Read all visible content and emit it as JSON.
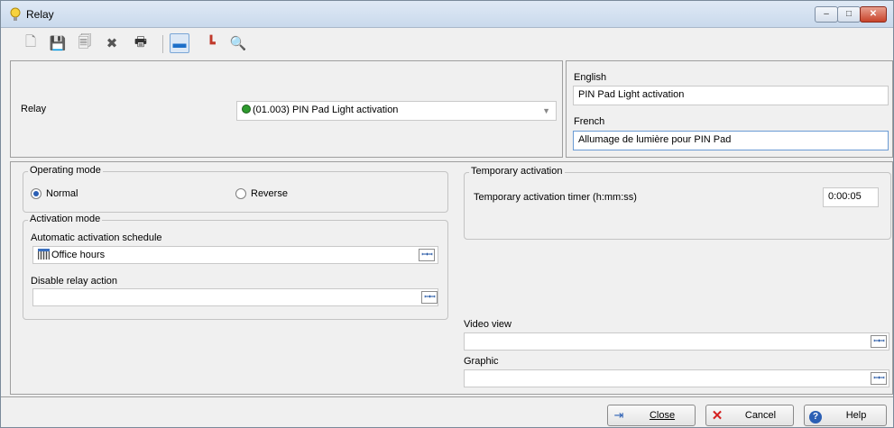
{
  "window": {
    "title": "Relay",
    "icon": "lightbulb-icon",
    "controls": {
      "minimize": "–",
      "maximize": "□",
      "close": "✕"
    }
  },
  "toolbar": {
    "items": [
      {
        "name": "new-icon",
        "glyph": "🗋"
      },
      {
        "name": "save-icon",
        "glyph": "💾"
      },
      {
        "name": "save-as-icon",
        "glyph": "🗐"
      },
      {
        "name": "delete-icon",
        "glyph": "✖"
      },
      {
        "name": "print-icon",
        "glyph": "🖶"
      },
      {
        "name": "link-icon",
        "glyph": "▬"
      },
      {
        "name": "relay-icon",
        "glyph": "┗"
      },
      {
        "name": "search-icon",
        "glyph": "🔍"
      }
    ]
  },
  "relay": {
    "label": "Relay",
    "selected": "(01.003) PIN Pad Light activation",
    "status_color": "#2e9a2e"
  },
  "names": {
    "english_label": "English",
    "english_value": "PIN Pad Light activation",
    "french_label": "French",
    "french_value": "Allumage de lumière pour PIN Pad"
  },
  "operating_mode": {
    "title": "Operating mode",
    "options": [
      {
        "label": "Normal",
        "checked": true
      },
      {
        "label": "Reverse",
        "checked": false
      }
    ]
  },
  "activation_mode": {
    "title": "Activation mode",
    "schedule_label": "Automatic activation schedule",
    "schedule_value": "Office hours",
    "disable_label": "Disable relay action",
    "disable_value": ""
  },
  "temporary_activation": {
    "title": "Temporary activation",
    "timer_label": "Temporary activation timer (h:mm:ss)",
    "timer_value": "0:00:05"
  },
  "video_view": {
    "label": "Video view",
    "value": ""
  },
  "graphic": {
    "label": "Graphic",
    "value": ""
  },
  "buttons": {
    "close": "Close",
    "cancel": "Cancel",
    "help": "Help"
  },
  "colors": {
    "accent": "#2b5fb4",
    "cancel_icon": "#d42020"
  }
}
